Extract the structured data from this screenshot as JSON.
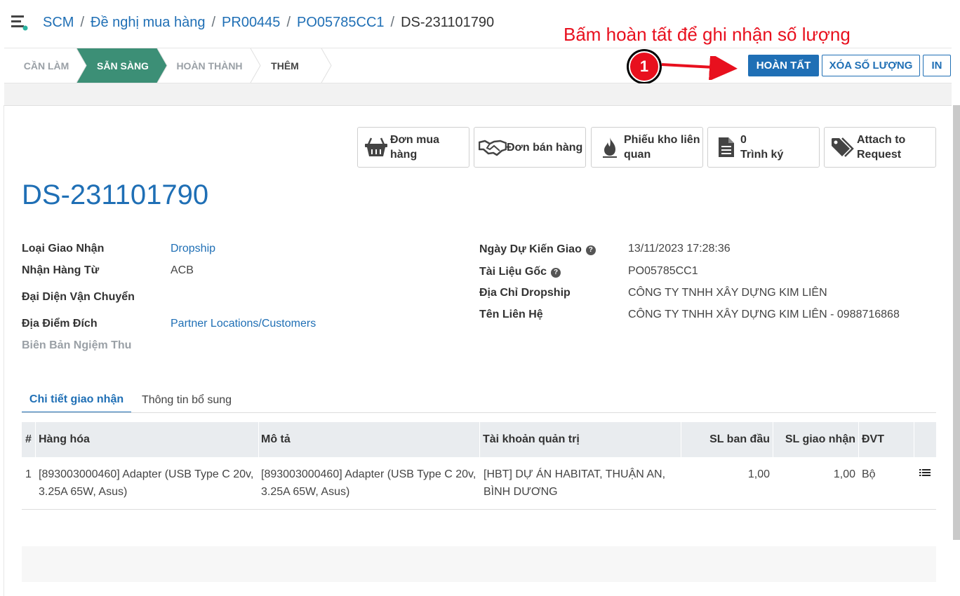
{
  "breadcrumb": {
    "items": [
      "SCM",
      "Đề nghị mua hàng",
      "PR00445",
      "PO05785CC1"
    ],
    "current": "DS-231101790",
    "separator": "/"
  },
  "annotation": {
    "text": "Bấm hoàn tất để ghi nhận số lượng",
    "badge": "1",
    "color": "#e8101e"
  },
  "statusbar": {
    "stages": [
      "CẦN LÀM",
      "SẴN SÀNG",
      "HOÀN THÀNH",
      "THÊM"
    ],
    "active_stage": "SẴN SÀNG",
    "active_color": "#3c8f76"
  },
  "actions": {
    "done": "HOÀN TẤT",
    "clear_qty": "XÓA SỐ LƯỢNG",
    "print": "IN"
  },
  "smart_buttons": {
    "purchase_order": "Đơn mua hàng",
    "sale_order": "Đơn bán hàng",
    "related_picking": "Phiếu kho liên quan",
    "sign_count": "0",
    "sign_label": "Trình ký",
    "attach": "Attach to Request"
  },
  "record": {
    "name": "DS-231101790"
  },
  "fields": {
    "picking_type_label": "Loại Giao Nhận",
    "picking_type_value": "Dropship",
    "receive_from_label": "Nhận Hàng Từ",
    "receive_from_value": "ACB",
    "carrier_label": "Đại Diện Vận Chuyển",
    "carrier_value": "",
    "dest_label": "Địa Điểm Đích",
    "dest_value": "Partner Locations/Customers",
    "acceptance_label": "Biên Bản Ngiệm Thu",
    "scheduled_label": "Ngày Dự Kiến Giao",
    "scheduled_value": "13/11/2023 17:28:36",
    "origin_label": "Tài Liệu Gốc",
    "origin_value": "PO05785CC1",
    "dropship_addr_label": "Địa Chỉ Dropship",
    "dropship_addr_value": "CÔNG TY TNHH XÂY DỰNG KIM LIÊN",
    "contact_label": "Tên Liên Hệ",
    "contact_value": "CÔNG TY TNHH XÂY DỰNG KIM LIÊN - 0988716868"
  },
  "tabs": {
    "detail": "Chi tiết giao nhận",
    "extra": "Thông tin bổ sung"
  },
  "table": {
    "headers": {
      "num": "#",
      "product": "Hàng hóa",
      "description": "Mô tả",
      "account": "Tài khoản quản trị",
      "initial_qty": "SL ban đầu",
      "done_qty": "SL giao nhận",
      "uom": "ĐVT"
    },
    "rows": [
      {
        "num": "1",
        "product_l1": "[893003000460] Adapter (USB Type C 20v,",
        "product_l2": "3.25A 65W, Asus)",
        "description_l1": "[893003000460] Adapter (USB Type C 20v,",
        "description_l2": "3.25A 65W, Asus)",
        "account_l1": "[HBT] DỰ ÁN HABITAT, THUẬN AN,",
        "account_l2": "BÌNH DƯƠNG",
        "initial_qty": "1,00",
        "done_qty": "1,00",
        "uom": "Bộ"
      }
    ]
  }
}
